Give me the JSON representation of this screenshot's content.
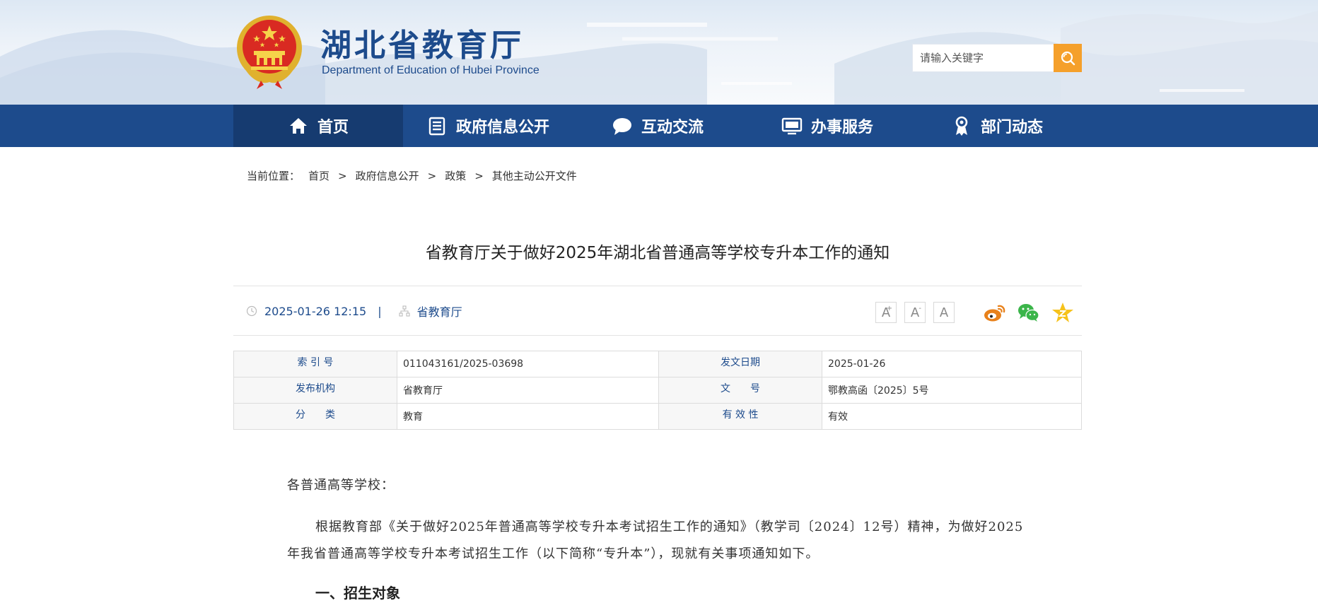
{
  "header": {
    "title": "湖北省教育厅",
    "subtitle": "Department of Education of Hubei Province",
    "search_placeholder": "请输入关键字"
  },
  "nav": {
    "items": [
      {
        "label": "首页",
        "icon": "home-icon",
        "active": true
      },
      {
        "label": "政府信息公开",
        "icon": "document-list-icon",
        "active": false
      },
      {
        "label": "互动交流",
        "icon": "chat-bubble-icon",
        "active": false
      },
      {
        "label": "办事服务",
        "icon": "monitor-icon",
        "active": false
      },
      {
        "label": "部门动态",
        "icon": "award-ribbon-icon",
        "active": false
      }
    ]
  },
  "breadcrumb": {
    "prefix": "当前位置：",
    "items": [
      "首页",
      "政府信息公开",
      "政策",
      "其他主动公开文件"
    ],
    "separator": ">"
  },
  "article": {
    "title": "省教育厅关于做好2025年湖北省普通高等学校专升本工作的通知",
    "date": "2025-01-26 12:15",
    "divider": "|",
    "source": "省教育厅"
  },
  "font_tools": {
    "large": "A",
    "large_mark": "+",
    "medium": "A",
    "medium_mark": "-",
    "small": "A"
  },
  "info_table": {
    "rows": [
      [
        {
          "label": "索 引 号",
          "value": "011043161/2025-03698"
        },
        {
          "label": "发文日期",
          "value": "2025-01-26"
        }
      ],
      [
        {
          "label": "发布机构",
          "value": "省教育厅"
        },
        {
          "label": "文　　号",
          "value": "鄂教高函〔2025〕5号"
        }
      ],
      [
        {
          "label": "分　　类",
          "value": "教育"
        },
        {
          "label": "有 效 性",
          "value": "有效"
        }
      ]
    ]
  },
  "content": {
    "greeting": "各普通高等学校：",
    "paragraph1": "根据教育部《关于做好2025年普通高等学校专升本考试招生工作的通知》（教学司〔2024〕12号）精神，为做好2025年我省普通高等学校专升本考试招生工作（以下简称“专升本”），现就有关事项通知如下。",
    "section1": "一、招生对象"
  },
  "colors": {
    "brand_blue": "#1d4b8c",
    "nav_active": "#163b70",
    "search_orange": "#f5a02b",
    "weibo_orange": "#e8811b",
    "wechat_green": "#3bb54a",
    "favorite_yellow": "#f6c21b"
  }
}
